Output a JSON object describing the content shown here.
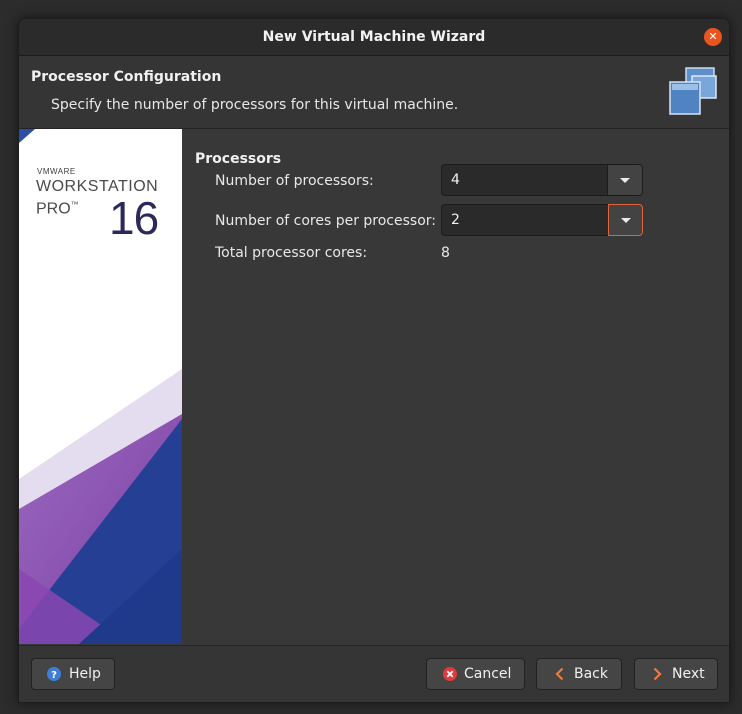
{
  "window": {
    "title": "New Virtual Machine Wizard"
  },
  "header": {
    "title": "Processor Configuration",
    "subtitle": "Specify the number of processors for this virtual machine."
  },
  "banner": {
    "brand_small": "VMWARE",
    "product": "WORKSTATION",
    "edition": "PRO",
    "trademark": "™",
    "version": "16",
    "colors": {
      "purple": "#7b3fa0",
      "navy": "#1f3a8a",
      "blue": "#2d4ea8"
    }
  },
  "processors": {
    "section_title": "Processors",
    "num_processors_label": "Number of processors:",
    "num_processors_value": "4",
    "cores_label": "Number of cores per processor:",
    "cores_value": "2",
    "total_label": "Total processor cores:",
    "total_value": "8"
  },
  "footer": {
    "help_label": "Help",
    "cancel_label": "Cancel",
    "back_label": "Back",
    "next_label": "Next"
  },
  "colors": {
    "accent": "#e9541f",
    "focus_border": "#e0643a",
    "help_blue": "#3d7fd6",
    "cancel_red": "#e23a3a"
  },
  "icons": [
    "close-icon",
    "vm-stack-icon",
    "dropdown-arrow-icon",
    "help-icon",
    "cancel-icon",
    "back-chevron-icon",
    "next-chevron-icon"
  ]
}
